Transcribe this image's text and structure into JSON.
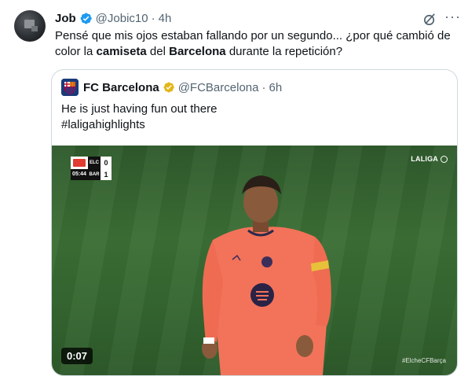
{
  "tweet": {
    "author_name": "Job",
    "handle": "@Jobic10",
    "separator": "·",
    "time": "4h",
    "more_label": "···",
    "text_parts": [
      {
        "text": "Pensé que mis ojos estaban fallando por un segundo... ¿por qué cambió de color la ",
        "bold": false
      },
      {
        "text": "camiseta",
        "bold": true
      },
      {
        "text": " del ",
        "bold": false
      },
      {
        "text": "Barcelona",
        "bold": true
      },
      {
        "text": " durante la repetición?",
        "bold": false
      }
    ]
  },
  "quoted": {
    "author_name": "FC Barcelona",
    "handle": "@FCBarcelona",
    "separator": "·",
    "time": "6h",
    "line1": "He is just having fun out there",
    "line2": "#laligahighlights",
    "video": {
      "duration": "0:07",
      "broadcaster": "LALIGA",
      "hashtag": "#ElcheCFBarça",
      "scoreboard": {
        "home_abbr": "ELC",
        "away_abbr": "BAR",
        "home_score": "0",
        "away_score": "1",
        "clock": "05:44"
      }
    }
  },
  "colors": {
    "verified_blue": "#1d9bf0",
    "verified_gold": "#e2b719",
    "muted_text": "#536471",
    "border": "#cfd9de",
    "pitch": "#3c6e35",
    "jersey": "#f2735a"
  },
  "icons": [
    "verified-badge-icon",
    "grok-icon",
    "more-icon",
    "gold-verified-badge-icon",
    "fcb-crest-icon"
  ]
}
